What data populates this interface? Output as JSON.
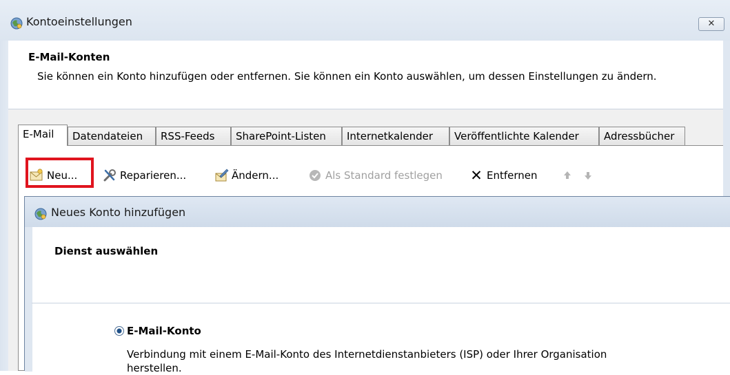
{
  "window": {
    "title": "Kontoeinstellungen",
    "close_symbol": "✕",
    "icon": "account-settings-icon"
  },
  "header": {
    "title": "E-Mail-Konten",
    "description": "Sie können ein Konto hinzufügen oder entfernen. Sie können ein Konto auswählen, um dessen Einstellungen zu ändern."
  },
  "tabs": [
    {
      "label": "E-Mail",
      "active": true
    },
    {
      "label": "Datendateien"
    },
    {
      "label": "RSS-Feeds"
    },
    {
      "label": "SharePoint-Listen"
    },
    {
      "label": "Internetkalender"
    },
    {
      "label": "Veröffentlichte Kalender"
    },
    {
      "label": "Adressbücher"
    }
  ],
  "toolbar": {
    "new_label": "Neu...",
    "repair_label": "Reparieren...",
    "change_label": "Ändern...",
    "default_label": "Als Standard festlegen",
    "remove_label": "Entfernen",
    "remove_symbol": "✕"
  },
  "dialog": {
    "title": "Neues Konto hinzufügen",
    "section_title": "Dienst auswählen",
    "option_label": "E-Mail-Konto",
    "option_description": "Verbindung mit einem E-Mail-Konto des Internetdienstanbieters (ISP) oder Ihrer Organisation herstellen."
  },
  "colors": {
    "highlight": "#e0141e",
    "titlebar": "#dce5f0",
    "radio": "#1e4f86"
  }
}
